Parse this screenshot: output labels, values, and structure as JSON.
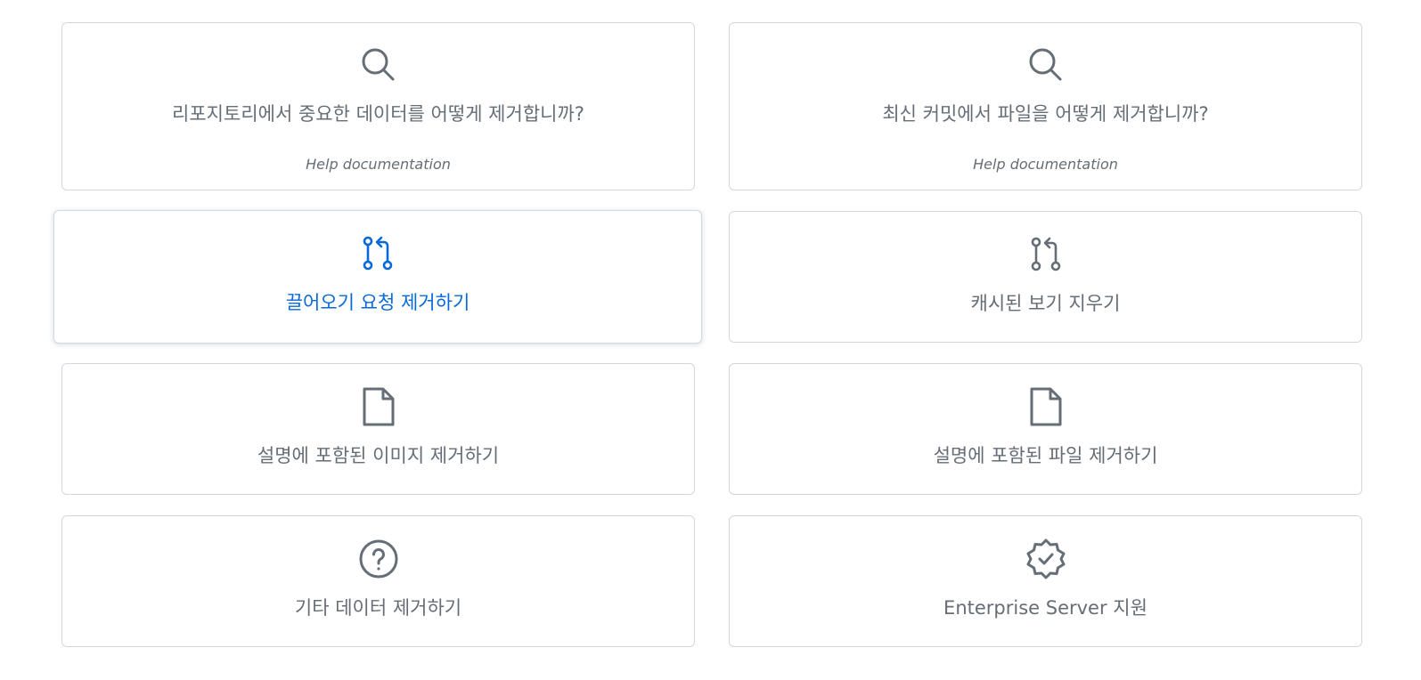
{
  "cards": [
    {
      "title": "리포지토리에서 중요한 데이터를 어떻게 제거합니까?",
      "subtitle": "Help documentation",
      "icon": "search-icon"
    },
    {
      "title": "최신 커밋에서 파일을 어떻게 제거합니까?",
      "subtitle": "Help documentation",
      "icon": "search-icon"
    },
    {
      "title": "끌어오기 요청 제거하기",
      "icon": "pull-request-icon",
      "state": "hover"
    },
    {
      "title": "캐시된 보기 지우기",
      "icon": "pull-request-icon"
    },
    {
      "title": "설명에 포함된 이미지 제거하기",
      "icon": "file-icon"
    },
    {
      "title": "설명에 포함된 파일 제거하기",
      "icon": "file-icon"
    },
    {
      "title": "기타 데이터 제거하기",
      "icon": "question-icon"
    },
    {
      "title": "Enterprise Server 지원",
      "icon": "verified-badge-icon"
    }
  ],
  "colors": {
    "text_muted": "#656d76",
    "accent_blue": "#0969da",
    "border": "#d0d7de",
    "icon_gray": "#656d76"
  }
}
